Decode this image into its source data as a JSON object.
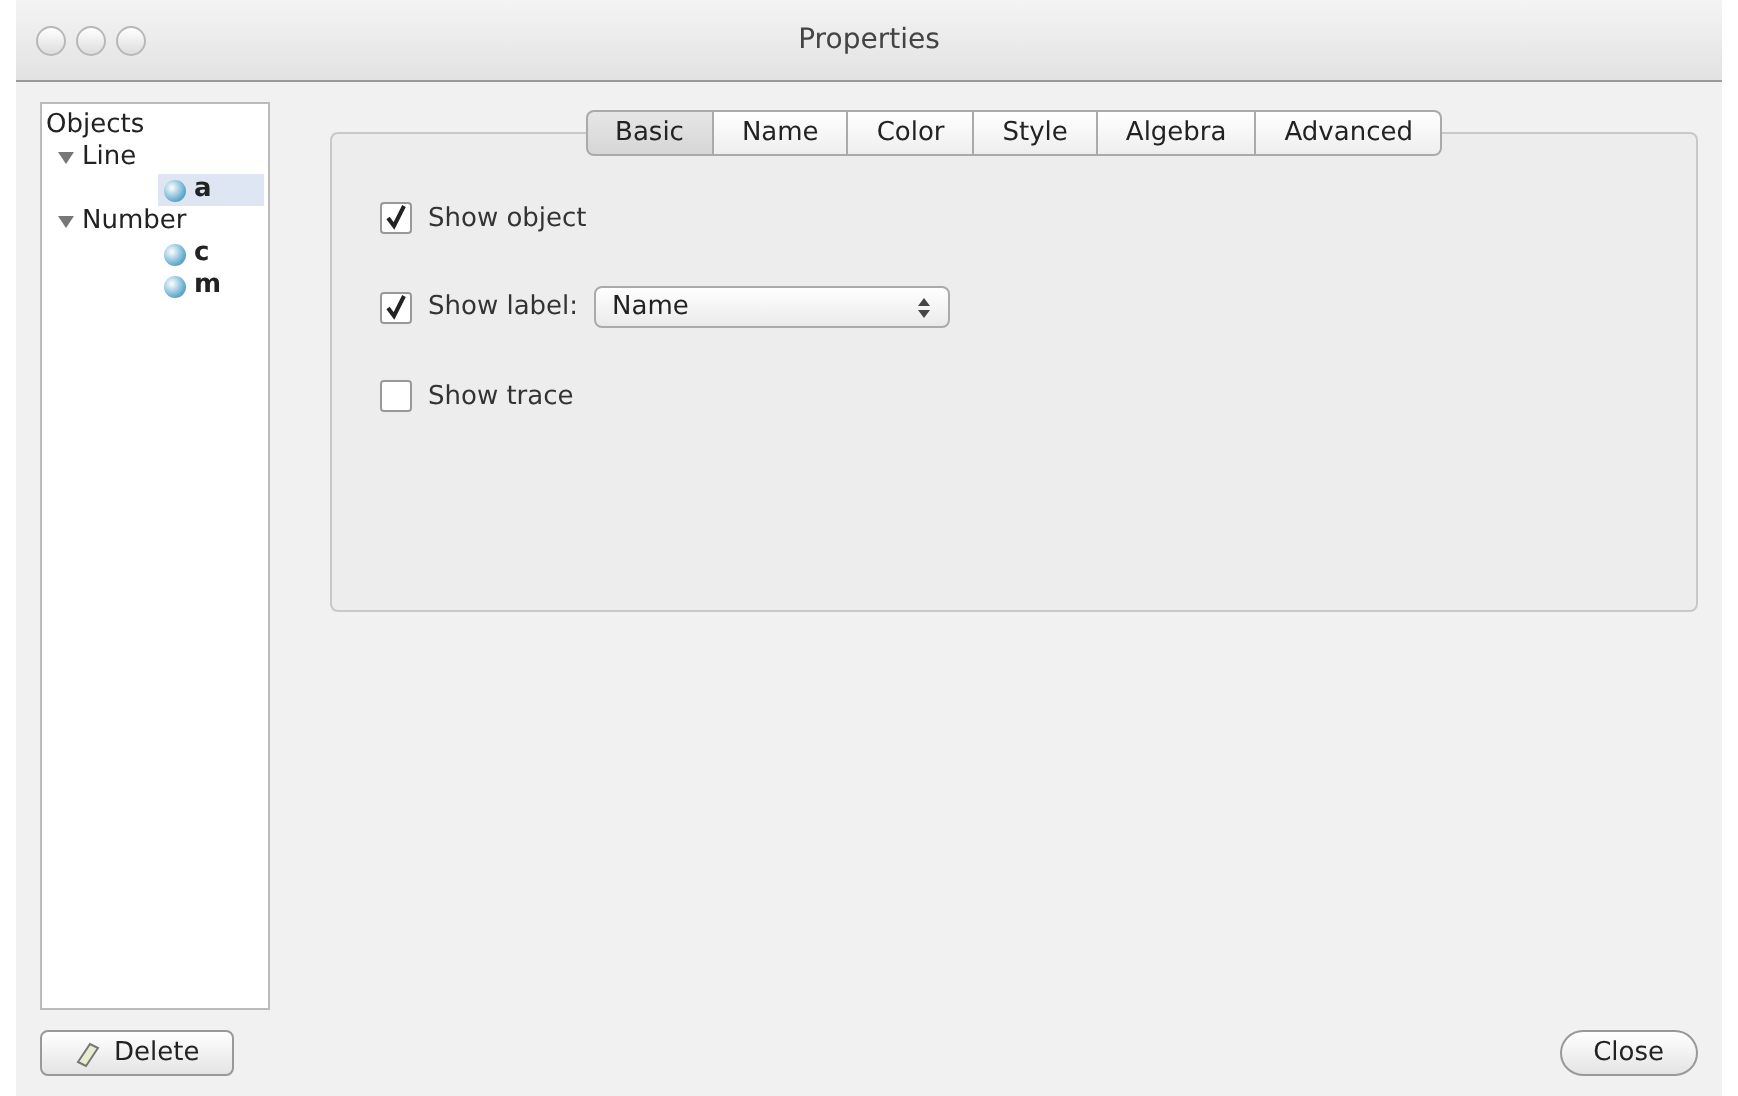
{
  "window": {
    "title": "Properties"
  },
  "tree": {
    "heading": "Objects",
    "children": [
      {
        "label": "Line",
        "expanded": true,
        "children": [
          {
            "label": "a",
            "selected": true
          }
        ]
      },
      {
        "label": "Number",
        "expanded": true,
        "children": [
          {
            "label": "c",
            "selected": false
          },
          {
            "label": "m",
            "selected": false
          }
        ]
      }
    ]
  },
  "tabs": [
    {
      "label": "Basic",
      "selected": true
    },
    {
      "label": "Name",
      "selected": false
    },
    {
      "label": "Color",
      "selected": false
    },
    {
      "label": "Style",
      "selected": false
    },
    {
      "label": "Algebra",
      "selected": false
    },
    {
      "label": "Advanced",
      "selected": false
    }
  ],
  "options": [
    {
      "label": "Show object",
      "checked": true
    },
    {
      "label": "Show label:",
      "checked": true,
      "select": "Name"
    },
    {
      "label": "Show trace",
      "checked": false
    }
  ],
  "buttons": {
    "delete": "Delete",
    "close": "Close"
  }
}
